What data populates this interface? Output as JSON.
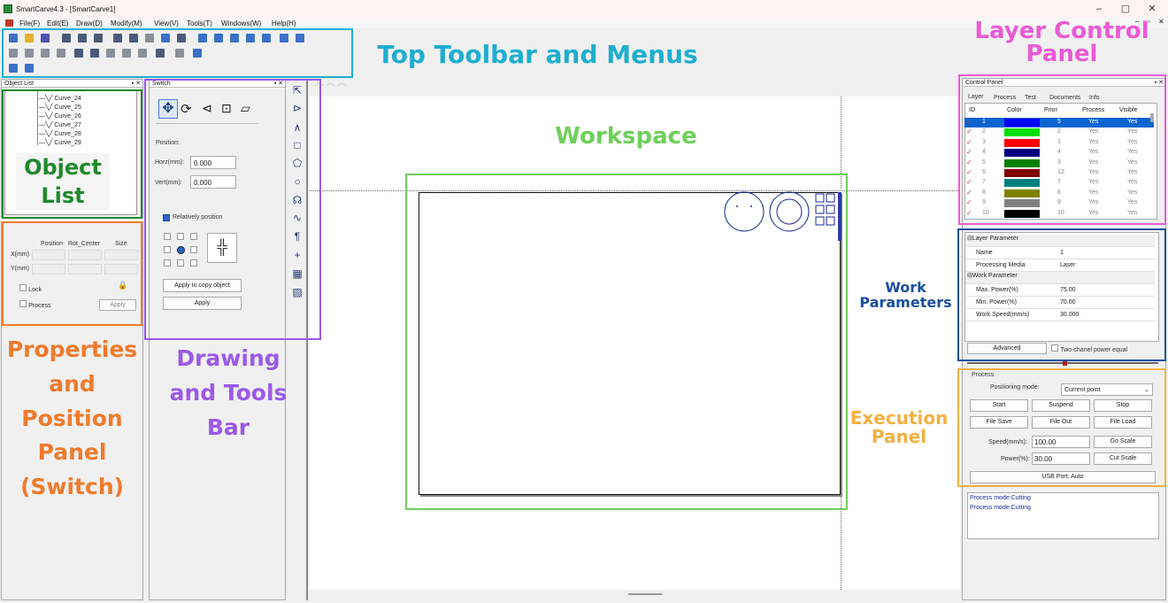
{
  "window": {
    "title": "SmartCarve4.3 - [SmartCarve1]",
    "controls": {
      "minimize": "–",
      "restore": "▢",
      "close": "✕"
    }
  },
  "menu": [
    "File(F)",
    "Edit(E)",
    "Draw(D)",
    "Modify(M)",
    "View(V)",
    "Tools(T)",
    "Windows(W)",
    "Help(H)"
  ],
  "mdi_controls": {
    "minimize": "–",
    "restore": "▫",
    "close": "✕"
  },
  "object_list": {
    "title": "Object List",
    "items": [
      "Curve_24",
      "Curve_25",
      "Curve_26",
      "Curve_27",
      "Curve_28",
      "Curve_29"
    ]
  },
  "properties": {
    "col_position": "Position",
    "col_rot_center": "Rot_Center",
    "col_size": "Size",
    "x_label": "X(mm)",
    "y_label": "Y(mm)",
    "lock_label": "Lock",
    "process_label": "Process",
    "apply_label": "Apply"
  },
  "switch": {
    "title": "Switch",
    "position_label": "Position:",
    "horz_label": "Horz(mm):",
    "horz_value": "0.000",
    "vert_label": "Vert(mm):",
    "vert_value": "0.000",
    "relatively_label": "Relatively position",
    "apply_copy_label": "Apply to copy object",
    "apply_label": "Apply"
  },
  "control_panel": {
    "title": "Control Panel",
    "tabs": [
      "Layer",
      "Process",
      "Test",
      "Documents",
      "Info"
    ],
    "columns": [
      "ID",
      "Color",
      "Prior",
      "Process",
      "Visible"
    ],
    "layers": [
      {
        "id": "1",
        "color": "#0000ff",
        "prior": "5",
        "process": "Yes",
        "visible": "Yes",
        "selected": true
      },
      {
        "id": "2",
        "color": "#00e000",
        "prior": "2",
        "process": "Yes",
        "visible": "Yes"
      },
      {
        "id": "3",
        "color": "#ff0000",
        "prior": "1",
        "process": "Yes",
        "visible": "Yes"
      },
      {
        "id": "4",
        "color": "#000080",
        "prior": "4",
        "process": "Yes",
        "visible": "Yes"
      },
      {
        "id": "5",
        "color": "#008000",
        "prior": "3",
        "process": "Yes",
        "visible": "Yes"
      },
      {
        "id": "6",
        "color": "#800000",
        "prior": "12",
        "process": "Yes",
        "visible": "Yes"
      },
      {
        "id": "7",
        "color": "#008080",
        "prior": "7",
        "process": "Yes",
        "visible": "Yes"
      },
      {
        "id": "8",
        "color": "#808000",
        "prior": "6",
        "process": "Yes",
        "visible": "Yes"
      },
      {
        "id": "9",
        "color": "#808080",
        "prior": "9",
        "process": "Yes",
        "visible": "Yes"
      },
      {
        "id": "10",
        "color": "#000000",
        "prior": "10",
        "process": "Yes",
        "visible": "Yes"
      }
    ]
  },
  "layer_params": {
    "layer_header": "Layer Parameter",
    "name_label": "Name",
    "name_value": "1",
    "media_label": "Processing Media",
    "media_value": "Laser",
    "work_header": "Work Parameter",
    "max_power_label": "Max. Power(%)",
    "max_power_value": "75.00",
    "min_power_label": "Min. Power(%)",
    "min_power_value": "70.00",
    "speed_label": "Work Speed(mm/s)",
    "speed_value": "30.000",
    "advanced_label": "Advanced",
    "two_channel_label": "Two-chanel power equal"
  },
  "process": {
    "title": "Process",
    "positioning_label": "Positioning mode:",
    "positioning_value": "Current point",
    "start": "Start",
    "suspend": "Suspend",
    "stop": "Stop",
    "file_save": "File Save",
    "file_out": "File Out",
    "file_load": "File Load",
    "speed_label": "Speed(mm/s):",
    "speed_value": "100.00",
    "go_scale": "Go Scale",
    "power_label": "Power(%):",
    "power_value": "30.00",
    "cut_scale": "Cut Scale",
    "usb_port": "USB Port: Auto",
    "log": [
      "Process mode:Cutting",
      "Process mode:Cutting"
    ]
  },
  "annotations": {
    "toolbar": "Top Toolbar and Menus",
    "layer_control": "Layer Control Panel",
    "workspace": "Workspace",
    "object_list": "Object List",
    "properties": "Properties and Position Panel (Switch)",
    "drawing": "Drawing and Tools Bar",
    "work_params": "Work Parameters",
    "execution": "Execution Panel"
  },
  "colors": {
    "toolbar": "#1eaed0",
    "layer_control": "#ea5ad6",
    "workspace": "#6fcf5b",
    "object_list": "#1f8a2c",
    "properties": "#f07a2c",
    "drawing": "#9b59e8",
    "work_params": "#1a4fa0",
    "execution": "#f5b041"
  }
}
